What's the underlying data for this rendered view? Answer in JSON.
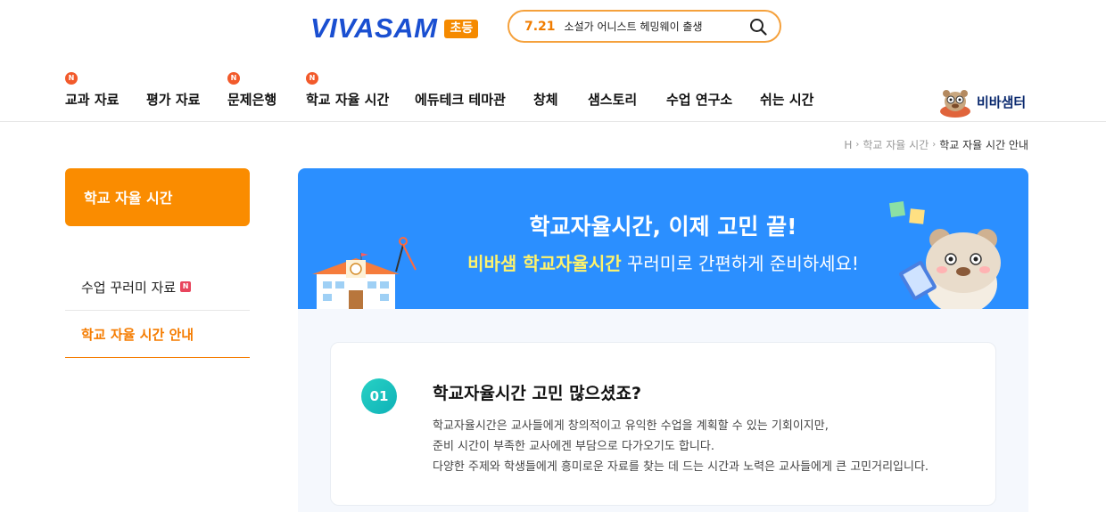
{
  "header": {
    "logo_text": "VIVASAM",
    "logo_badge": "초등",
    "search": {
      "date": "7.21",
      "keyword": "소설가 어니스트 헤밍웨이 출생"
    },
    "nav": [
      {
        "label": "교과 자료",
        "new": "N"
      },
      {
        "label": "평가 자료",
        "new": ""
      },
      {
        "label": "문제은행",
        "new": "N"
      },
      {
        "label": "학교 자율 시간",
        "new": "N"
      },
      {
        "label": "에듀테크 테마관",
        "new": ""
      },
      {
        "label": "창체",
        "new": ""
      },
      {
        "label": "샘스토리",
        "new": ""
      },
      {
        "label": "수업 연구소",
        "new": ""
      },
      {
        "label": "쉬는 시간",
        "new": ""
      }
    ],
    "vivasam_center": "비바샘터"
  },
  "breadcrumb": {
    "home": "H",
    "section": "학교 자율 시간",
    "current": "학교 자율 시간 안내"
  },
  "sidebar": {
    "title": "학교 자율 시간",
    "items": [
      {
        "label": "수업 꾸러미 자료",
        "badge": "N"
      },
      {
        "label": "학교 자율 시간 안내"
      }
    ]
  },
  "banner": {
    "title": "학교자율시간, 이제 고민 끝!",
    "subtitle_highlight": "비바샘 학교자율시간",
    "subtitle_rest": " 꾸러미로 간편하게 준비하세요!"
  },
  "step": {
    "number": "01",
    "title": "학교자율시간 고민 많으셨죠?",
    "lines": [
      "학교자율시간은 교사들에게 창의적이고 유익한 수업을 계획할 수 있는 기회이지만,",
      "준비 시간이 부족한 교사에겐 부담으로 다가오기도 합니다.",
      "다양한 주제와 학생들에게 흥미로운 자료를 찾는 데 드는 시간과 노력은 교사들에게 큰 고민거리입니다."
    ]
  },
  "colors": {
    "accent": "#fa8c00",
    "banner": "#2b8fff",
    "brand": "#1a4fd1",
    "new_badge": "#f25a2b"
  }
}
